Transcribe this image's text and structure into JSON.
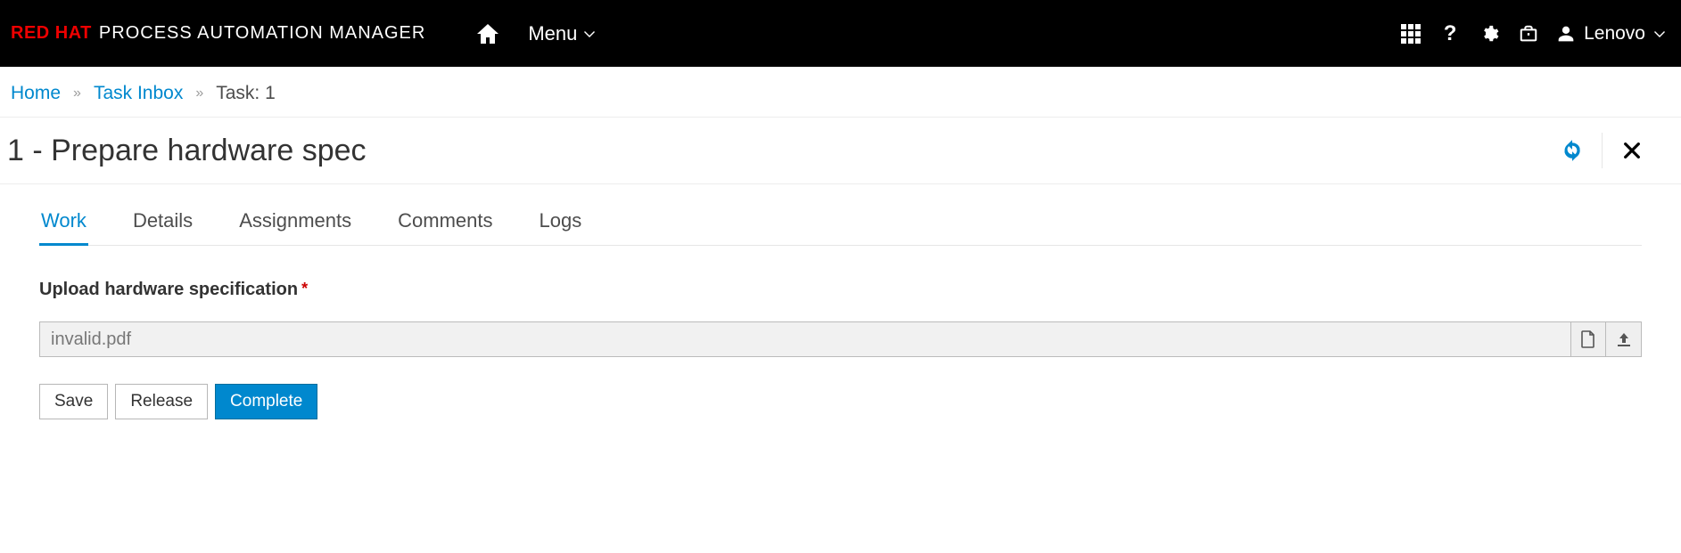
{
  "brand": {
    "red": "RED HAT",
    "rest": "PROCESS AUTOMATION MANAGER"
  },
  "topbar": {
    "menu_label": "Menu",
    "user_label": "Lenovo"
  },
  "breadcrumb": {
    "home": "Home",
    "task_inbox": "Task Inbox",
    "current": "Task: 1"
  },
  "page": {
    "title": "1 - Prepare hardware spec"
  },
  "tabs": {
    "work": "Work",
    "details": "Details",
    "assignments": "Assignments",
    "comments": "Comments",
    "logs": "Logs",
    "active": "work"
  },
  "form": {
    "upload_label": "Upload hardware specification",
    "required_mark": "*",
    "file_value": "invalid.pdf"
  },
  "buttons": {
    "save": "Save",
    "release": "Release",
    "complete": "Complete"
  }
}
